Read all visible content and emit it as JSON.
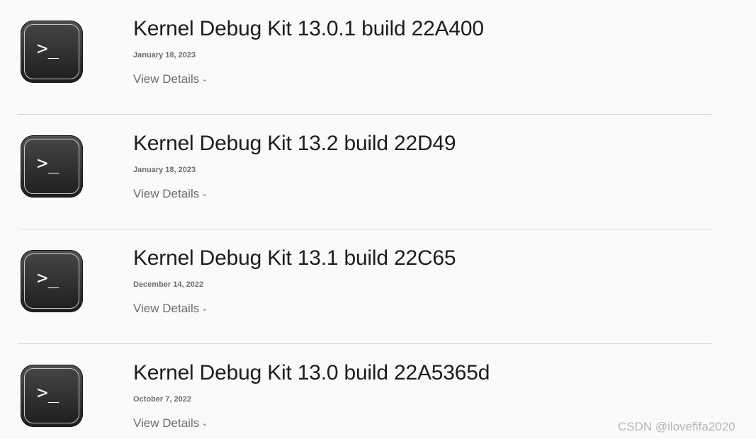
{
  "items": [
    {
      "prompt": ">_",
      "title": "Kernel Debug Kit 13.0.1 build 22A400",
      "date": "January 18, 2023",
      "details_label": "View Details"
    },
    {
      "prompt": ">_",
      "title": "Kernel Debug Kit 13.2 build 22D49",
      "date": "January 18, 2023",
      "details_label": "View Details"
    },
    {
      "prompt": ">_",
      "title": "Kernel Debug Kit 13.1 build 22C65",
      "date": "December 14, 2022",
      "details_label": "View Details"
    },
    {
      "prompt": ">_",
      "title": "Kernel Debug Kit 13.0 build 22A5365d",
      "date": "October 7, 2022",
      "details_label": "View Details"
    }
  ],
  "icons": {
    "app_icon": "terminal-icon",
    "details_chevron": "chevron-down-icon",
    "chevron_glyph": "⌄"
  },
  "watermark": "CSDN @ilovefifa2020",
  "colors": {
    "background": "#fafafc",
    "title_text": "#1d1d1f",
    "secondary_text": "#6e6e73",
    "divider": "#d2d2d7",
    "icon_dark": "#1e1e1e"
  }
}
